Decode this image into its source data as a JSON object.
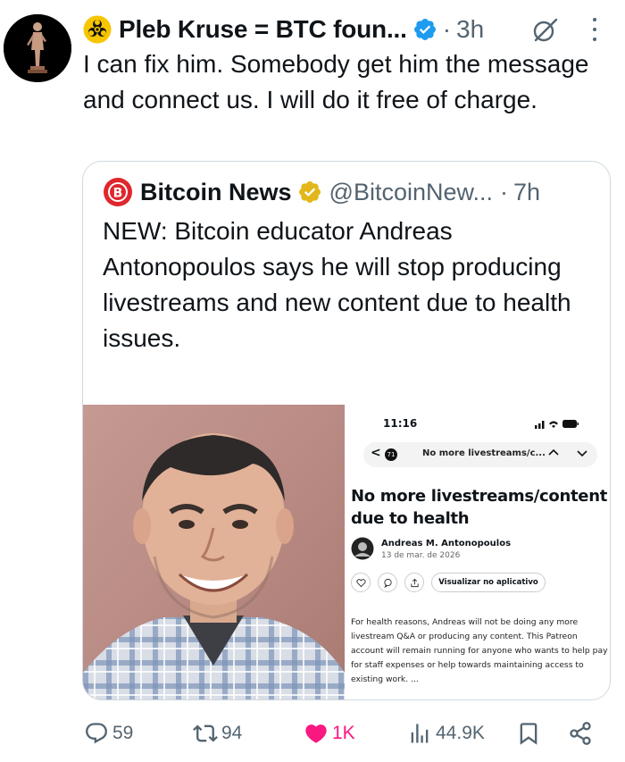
{
  "tweet": {
    "display_name": "Pleb Kruse = BTC foun...",
    "time": "3h",
    "separator": "·",
    "text": "I can fix him.  Somebody get him the message and connect us.  I will do it free of charge."
  },
  "quote": {
    "display_name": "Bitcoin News",
    "handle": "@BitcoinNew...",
    "separator": "·",
    "time": "7h",
    "text": "NEW: Bitcoin educator Andreas Antonopoulos says he will stop producing livestreams and new content due to health issues.",
    "ellipsis": "...",
    "phone": {
      "status_time": "11:16",
      "back": "<",
      "count": "71",
      "nav_title": "No more livestreams/c...",
      "title": "No more livestreams/content due to health",
      "author": "Andreas M. Antonopoulos",
      "date": "13 de mar. de 2026",
      "visualizar": "Visualizar no aplicativo",
      "body": "For health reasons, Andreas will not be doing any more livestream Q&A or producing any content. This Patreon account will remain running for anyone who wants to help pay for staff expenses or help towards maintaining access to existing work. ..."
    }
  },
  "actions": {
    "replies": "59",
    "reposts": "94",
    "likes": "1K",
    "views": "44.9K"
  },
  "colors": {
    "text": "#0f1419",
    "secondary": "#536471",
    "verified_blue": "#1d9bf0",
    "verified_gold": "#e2b719",
    "like_pink": "#f91880",
    "border": "#cfd9de",
    "bitcoin_red": "#e0262d"
  },
  "icons": [
    "biohazard-icon",
    "verified-badge-icon",
    "grok-icon",
    "more-icon",
    "bitcoin-logo-icon",
    "reply-icon",
    "repost-icon",
    "like-icon",
    "views-icon",
    "bookmark-icon",
    "share-icon"
  ]
}
